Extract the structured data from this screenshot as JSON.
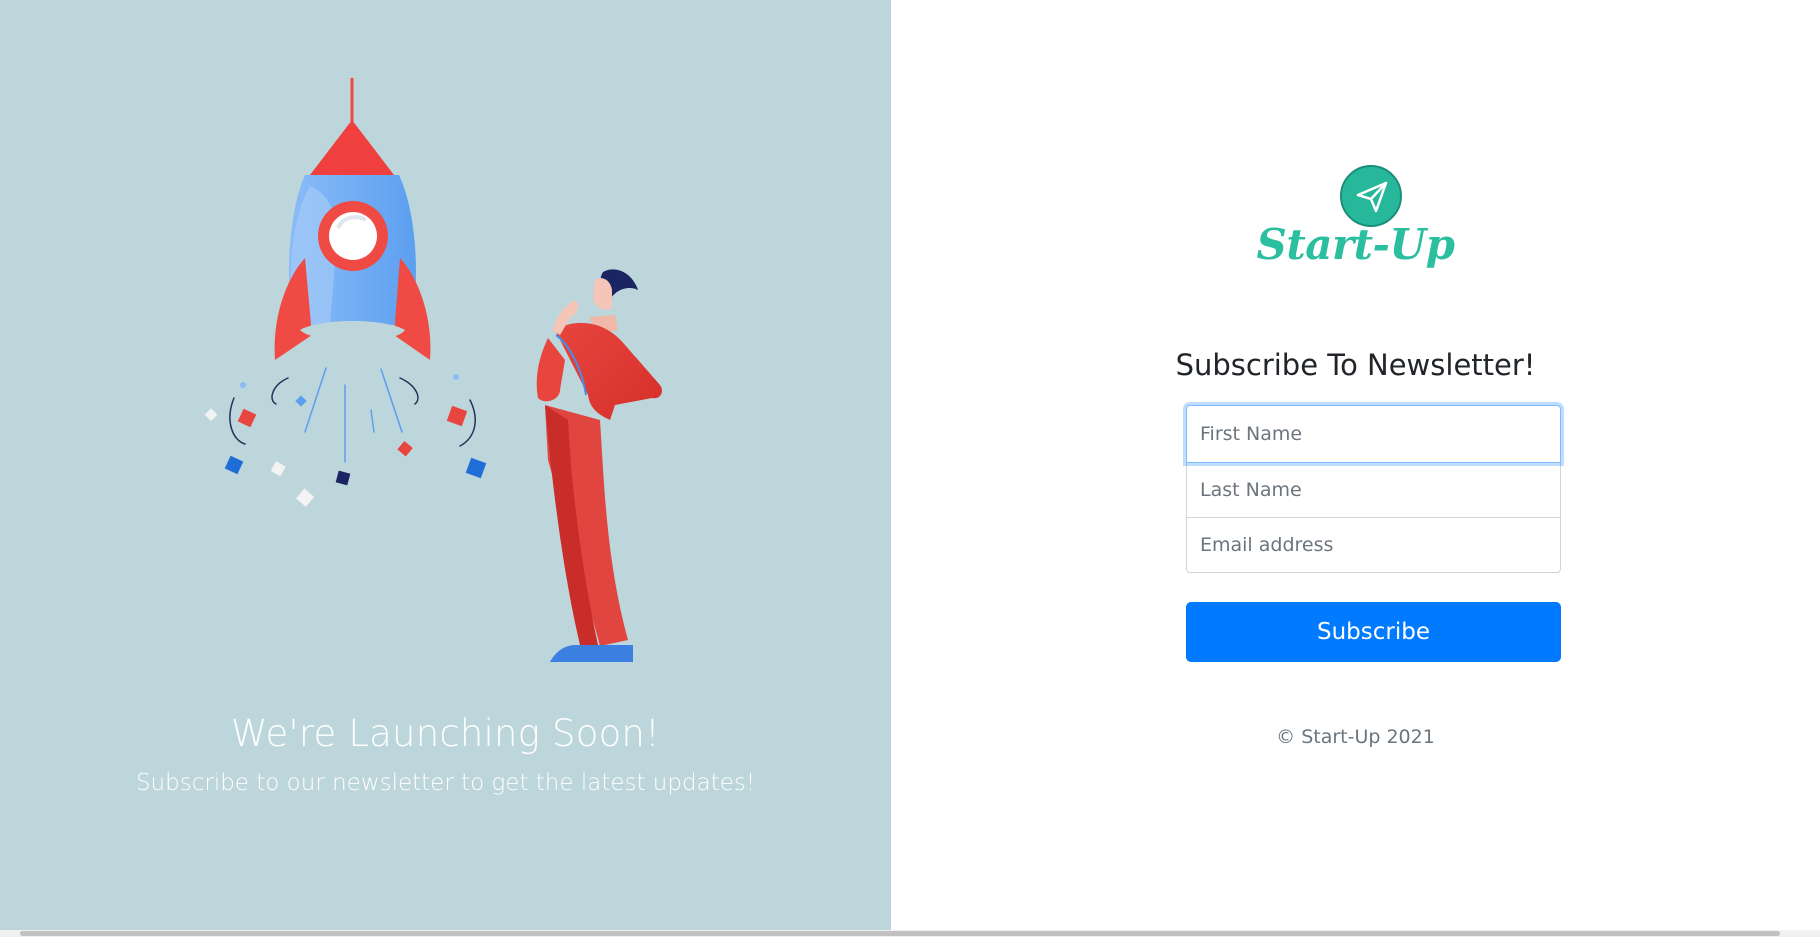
{
  "hero": {
    "headline": "We're Launching Soon!",
    "subtext": "Subscribe to our newsletter to get the latest updates!"
  },
  "brand": {
    "logo_icon": "paper-plane-icon",
    "name": "Start-Up",
    "color": "#2bbf9f"
  },
  "form": {
    "title": "Subscribe To Newsletter!",
    "first_name": {
      "placeholder": "First Name",
      "value": ""
    },
    "last_name": {
      "placeholder": "Last Name",
      "value": ""
    },
    "email": {
      "placeholder": "Email address",
      "value": ""
    },
    "submit_label": "Subscribe",
    "button_color": "#007bff"
  },
  "footer": {
    "copyright": "© Start-Up 2021"
  },
  "colors": {
    "left_background": "#bdd6db",
    "right_background": "#ffffff"
  }
}
